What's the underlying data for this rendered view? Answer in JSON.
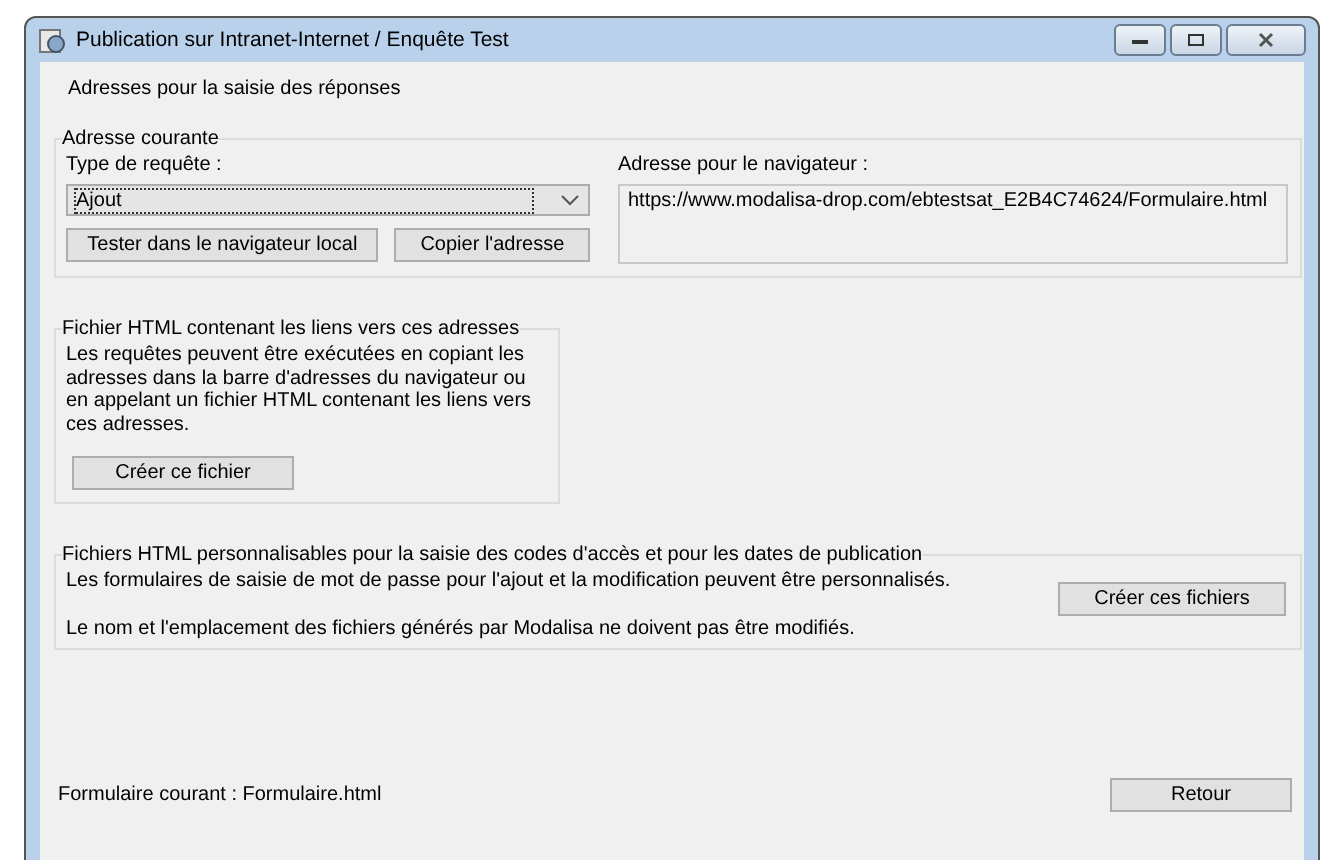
{
  "window": {
    "title": "Publication sur Intranet-Internet / Enquête Test"
  },
  "heading": "Adresses pour la saisie des réponses",
  "current_address": {
    "legend": "Adresse courante",
    "request_type_label": "Type de requête :",
    "request_type": "Ajout",
    "test_button": "Tester dans le navigateur local",
    "copy_button": "Copier l'adresse",
    "browser_address_label": "Adresse pour le navigateur :",
    "browser_address": "https://www.modalisa-drop.com/ebtestsat_E2B4C74624/Formulaire.html"
  },
  "html_links": {
    "legend": "Fichier HTML contenant les liens vers ces adresses",
    "text": "Les requêtes peuvent être exécutées en copiant les adresses dans la barre d'adresses du navigateur ou en appelant un fichier HTML contenant les liens vers ces adresses.",
    "button": "Créer ce fichier"
  },
  "custom_files": {
    "legend": "Fichiers HTML personnalisables pour la saisie des codes d'accès et pour les dates de publication",
    "text": "Les formulaires de saisie de mot de passe pour l'ajout et la modification peuvent être personnalisés.",
    "note": "Le nom et l'emplacement des fichiers générés par Modalisa ne doivent pas être modifiés.",
    "button": "Créer ces fichiers"
  },
  "status": "Formulaire courant : Formulaire.html",
  "return_button": "Retour"
}
